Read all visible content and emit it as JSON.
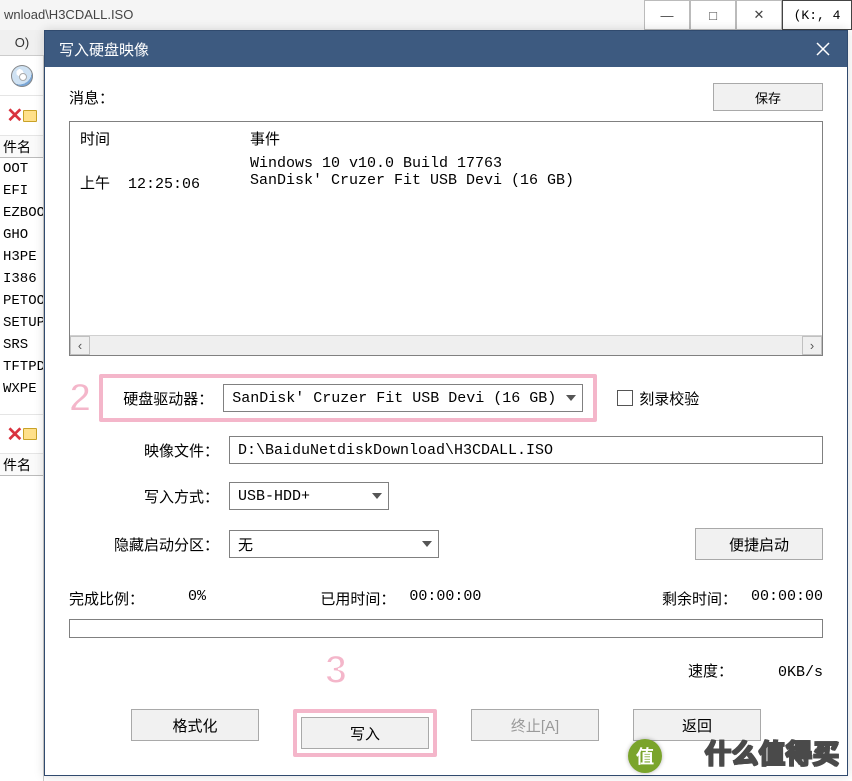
{
  "parent": {
    "title_fragment": "wnload\\H3CDALL.ISO",
    "menu_fragment": "O)",
    "window_min": "—",
    "window_max": "□",
    "window_close": "✕",
    "drive_badge": "(K:, 4",
    "list_header": "件名",
    "files": [
      "OOT",
      "EFI",
      "EZBOOT",
      "GHO",
      "H3PE",
      "I386",
      "PETOO",
      "SETUP",
      "SRS",
      "TFTPD",
      "WXPE"
    ]
  },
  "dialog": {
    "title": "写入硬盘映像",
    "messages_label": "消息：",
    "save_btn": "保存",
    "log": {
      "col_time": "时间",
      "col_event": "事件",
      "rows": [
        {
          "time": "",
          "event": "Windows 10 v10.0 Build 17763"
        },
        {
          "time": "上午  12:25:06",
          "event": "SanDisk' Cruzer Fit USB Devi (16 GB)"
        }
      ]
    },
    "drive_label": "硬盘驱动器：",
    "drive_value": "SanDisk' Cruzer Fit USB Devi (16 GB)",
    "burn_verify": "刻录校验",
    "image_label": "映像文件：",
    "image_value": "D:\\BaiduNetdiskDownload\\H3CDALL.ISO",
    "method_label": "写入方式：",
    "method_value": "USB-HDD+",
    "hidden_label": "隐藏启动分区：",
    "hidden_value": "无",
    "quick_boot_btn": "便捷启动",
    "done_ratio_label": "完成比例：",
    "done_ratio_value": "0%",
    "elapsed_label": "已用时间：",
    "elapsed_value": "00:00:00",
    "remaining_label": "剩余时间：",
    "remaining_value": "00:00:00",
    "speed_label": "速度：",
    "speed_value": "0KB/s",
    "btn_format": "格式化",
    "btn_write": "写入",
    "btn_abort": "终止[A]",
    "btn_back": "返回"
  },
  "annotations": {
    "num2": "2",
    "num3": "3"
  },
  "signature": {
    "badge": "值",
    "text": "什么值得买"
  }
}
